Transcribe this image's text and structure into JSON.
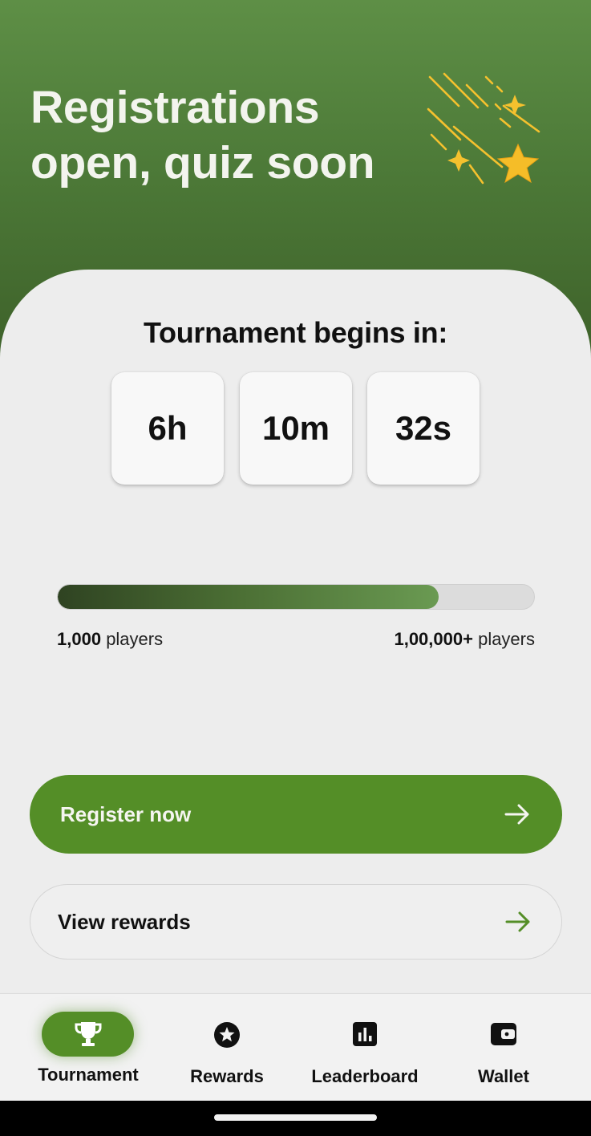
{
  "hero": {
    "title_line1": "Registrations",
    "title_line2": "open, quiz soon",
    "art_icon": "shooting-stars-icon"
  },
  "countdown": {
    "title": "Tournament begins in:",
    "hours": "6h",
    "minutes": "10m",
    "seconds": "32s"
  },
  "progress": {
    "fill_fraction": 0.8,
    "min_value": "1,000",
    "min_unit": "players",
    "max_value": "1,00,000+",
    "max_unit": "players"
  },
  "actions": {
    "register_label": "Register now",
    "rewards_label": "View rewards"
  },
  "nav": {
    "items": [
      {
        "label": "Tournament",
        "icon": "trophy-icon",
        "active": true
      },
      {
        "label": "Rewards",
        "icon": "star-badge-icon",
        "active": false
      },
      {
        "label": "Leaderboard",
        "icon": "bar-chart-icon",
        "active": false
      },
      {
        "label": "Wallet",
        "icon": "wallet-icon",
        "active": false
      }
    ]
  },
  "colors": {
    "brand_green": "#548e27",
    "hero_green": "#4d7a38",
    "star_gold": "#f5c12e"
  }
}
